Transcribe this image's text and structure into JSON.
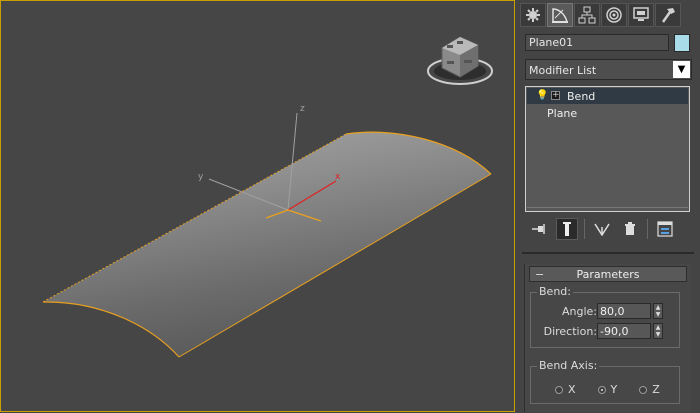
{
  "viewport": {
    "axis_labels": {
      "x": "x",
      "y": "y",
      "z": "z"
    },
    "selection_color": "#e8a020"
  },
  "panel": {
    "tabs": [
      {
        "icon": "create-icon"
      },
      {
        "icon": "modify-icon"
      },
      {
        "icon": "hierarchy-icon"
      },
      {
        "icon": "motion-icon"
      },
      {
        "icon": "display-icon"
      },
      {
        "icon": "utilities-icon"
      }
    ],
    "object_name": "Plane01",
    "object_color": "#a8dce8",
    "modifier_list_label": "Modifier List",
    "stack": [
      {
        "label": "Bend",
        "selected": true
      },
      {
        "label": "Plane",
        "selected": false
      }
    ],
    "parameters": {
      "title": "Parameters",
      "bend_group": "Bend:",
      "angle_label": "Angle:",
      "angle_value": "80,0",
      "direction_label": "Direction:",
      "direction_value": "-90,0",
      "axis_group": "Bend Axis:",
      "axes": [
        {
          "label": "X",
          "selected": false
        },
        {
          "label": "Y",
          "selected": true
        },
        {
          "label": "Z",
          "selected": false
        }
      ]
    }
  }
}
